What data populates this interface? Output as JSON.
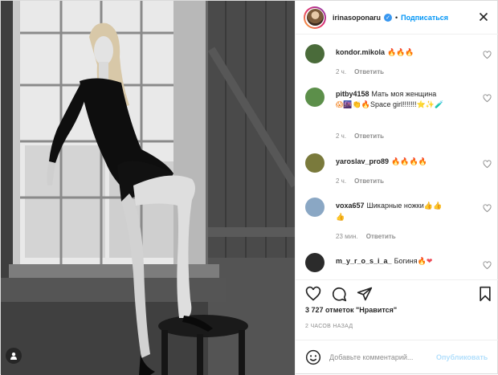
{
  "post": {
    "author": "irinasoponaru",
    "follow_label": "Подписаться",
    "separator": "•",
    "likes_text": "3 727 отметок \"Нравится\"",
    "time_text": "2 ЧАСОВ НАЗАД"
  },
  "comments": [
    {
      "user": "kondor.mikola",
      "text": "",
      "emoji": "🔥🔥🔥",
      "time": "2 ч.",
      "reply": "Ответить",
      "avatar_color": "#4a6b3a"
    },
    {
      "user": "pitby4158",
      "text": "Мать моя женщина",
      "emoji": "😱🌆👏🔥",
      "text2": "Space girl!!!!!!!",
      "emoji2": "⭐✨🧪",
      "time": "2 ч.",
      "reply": "Ответить",
      "avatar_color": "#5c8f4a"
    },
    {
      "user": "yaroslav_pro89",
      "text": "",
      "emoji": "🔥🔥🔥🔥",
      "time": "2 ч.",
      "reply": "Ответить",
      "avatar_color": "#7a7a3c"
    },
    {
      "user": "voxa657",
      "text": "Шикарные ножки",
      "emoji": "👍👍",
      "emoji2": "👍",
      "time": "23 мин.",
      "reply": "Ответить",
      "avatar_color": "#8aa7c4"
    },
    {
      "user": "m_y_r_o_s_i_a_",
      "text": "Богиня",
      "emoji": "🔥❤",
      "time": "",
      "reply": "",
      "avatar_color": "#2b2b2b"
    }
  ],
  "add_comment": {
    "placeholder": "Добавьте комментарий...",
    "publish_label": "Опубликовать"
  },
  "colors": {
    "accent": "#0095f6",
    "publish_disabled": "#b2dffc",
    "muted": "#8e8e8e",
    "border": "#dbdbdb"
  },
  "icons": [
    "more-options-icon",
    "heart-icon",
    "comment-icon",
    "share-icon",
    "bookmark-icon",
    "emoji-icon",
    "user-tag-icon",
    "verified-badge-icon"
  ]
}
